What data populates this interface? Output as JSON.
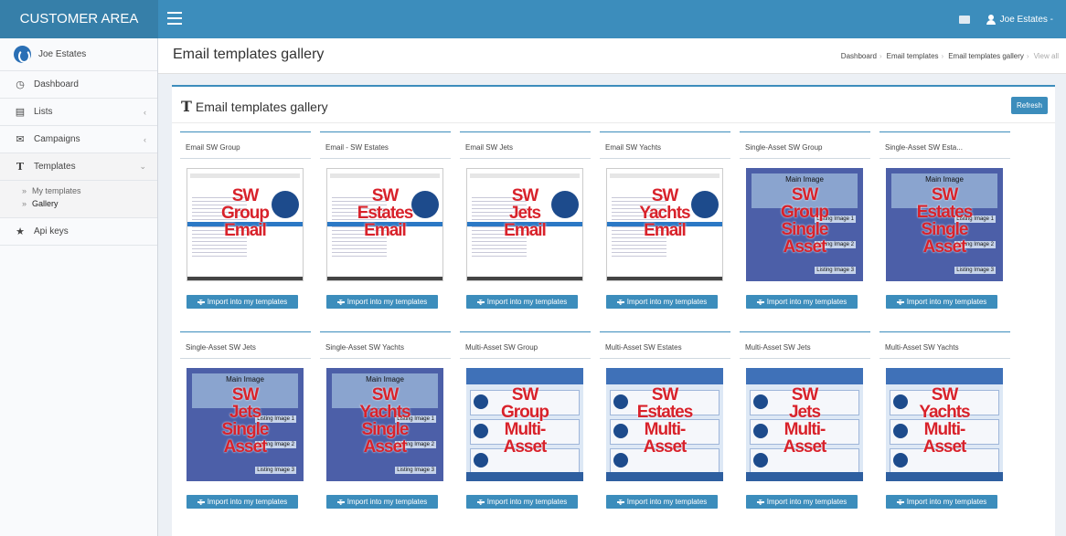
{
  "header": {
    "brand": "CUSTOMER AREA",
    "user_menu": "Joe Estates -"
  },
  "sidebar": {
    "user_name": "Joe Estates",
    "items": [
      {
        "label": "Dashboard",
        "icon": "dashboard-icon"
      },
      {
        "label": "Lists",
        "icon": "list-icon"
      },
      {
        "label": "Campaigns",
        "icon": "envelope-icon"
      },
      {
        "label": "Templates",
        "icon": "text-icon"
      },
      {
        "label": "Api keys",
        "icon": "star-icon"
      }
    ],
    "sub_items": [
      {
        "label": "My templates"
      },
      {
        "label": "Gallery"
      }
    ]
  },
  "page": {
    "title": "Email templates gallery",
    "breadcrumb": [
      "Dashboard",
      "Email templates",
      "Email templates gallery",
      "View all"
    ]
  },
  "box": {
    "title": "Email templates gallery",
    "refresh_label": "Refresh",
    "import_label": "Import into my templates"
  },
  "templates": [
    {
      "name": "Email SW Group",
      "kind": "email",
      "overlay": [
        "SW",
        "Group",
        "Email"
      ]
    },
    {
      "name": "Email - SW Estates",
      "kind": "email",
      "overlay": [
        "SW",
        "Estates",
        "Email"
      ]
    },
    {
      "name": "Email SW Jets",
      "kind": "email",
      "overlay": [
        "SW",
        "Jets",
        "Email"
      ]
    },
    {
      "name": "Email SW Yachts",
      "kind": "email",
      "overlay": [
        "SW",
        "Yachts",
        "Email"
      ]
    },
    {
      "name": "Single-Asset SW Group",
      "kind": "single",
      "overlay": [
        "SW",
        "Group",
        "Single",
        "Asset"
      ]
    },
    {
      "name": "Single-Asset SW Esta...",
      "kind": "single",
      "overlay": [
        "SW",
        "Estates",
        "Single",
        "Asset"
      ]
    },
    {
      "name": "Single-Asset SW Jets",
      "kind": "single",
      "overlay": [
        "SW",
        "Jets",
        "Single",
        "Asset"
      ]
    },
    {
      "name": "Single-Asset SW Yachts",
      "kind": "single",
      "overlay": [
        "SW",
        "Yachts",
        "Single",
        "Asset"
      ]
    },
    {
      "name": "Multi-Asset SW Group",
      "kind": "multi",
      "overlay": [
        "SW",
        "Group",
        "Multi-",
        "Asset"
      ]
    },
    {
      "name": "Multi-Asset SW Estates",
      "kind": "multi",
      "overlay": [
        "SW",
        "Estates",
        "Multi-",
        "Asset"
      ]
    },
    {
      "name": "Multi-Asset SW Jets",
      "kind": "multi",
      "overlay": [
        "SW",
        "Jets",
        "Multi-",
        "Asset"
      ]
    },
    {
      "name": "Multi-Asset SW Yachts",
      "kind": "multi",
      "overlay": [
        "SW",
        "Yachts",
        "Multi-",
        "Asset"
      ]
    }
  ],
  "thumb_text": {
    "main_image": "Main Image",
    "listing_1": "Listing Image 1",
    "listing_2": "Listing Image 2",
    "listing_3": "Listing Image 3"
  }
}
